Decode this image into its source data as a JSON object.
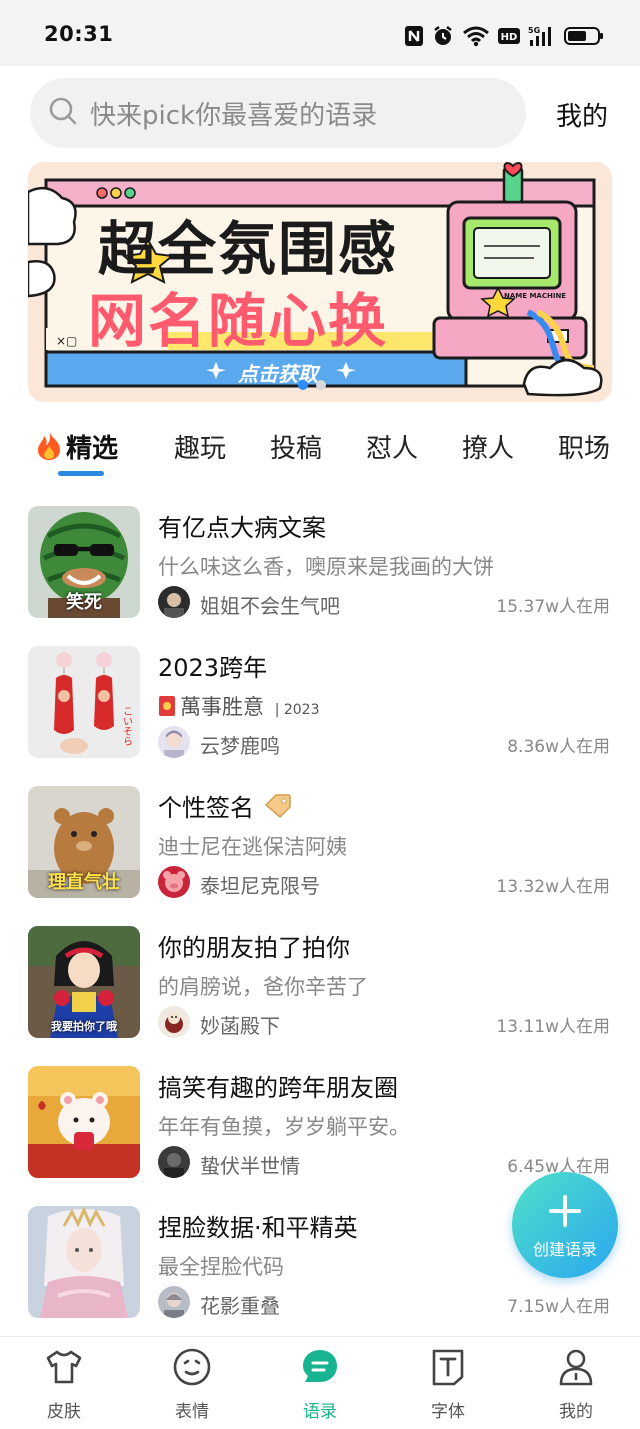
{
  "status_bar": {
    "time": "20:31",
    "icons": [
      "nfc-icon",
      "alarm-icon",
      "wifi-icon",
      "hd-icon",
      "signal-5g-icon",
      "battery-icon"
    ]
  },
  "search": {
    "placeholder": "快来pick你最喜爱的语录",
    "icon": "search-icon"
  },
  "header": {
    "mine_link": "我的"
  },
  "banner": {
    "line1": "超全氛围感",
    "line2": "网名随心换",
    "cta": "点击获取",
    "machine_label": "NAME MACHINE",
    "slide_count": 2,
    "active_slide": 0
  },
  "tabs": [
    {
      "label": "精选",
      "icon": "fire-icon",
      "active": true
    },
    {
      "label": "趣玩"
    },
    {
      "label": "投稿"
    },
    {
      "label": "怼人"
    },
    {
      "label": "撩人"
    },
    {
      "label": "职场"
    }
  ],
  "items": [
    {
      "title": "有亿点大病文案",
      "subtitle": "什么味这么香，噢原来是我画的大饼",
      "author": "姐姐不会生气吧",
      "users": "15.37w人在用",
      "thumb_caption": "笑死"
    },
    {
      "title": "2023跨年",
      "subtitle": "萬事胜意",
      "subtitle_tag": "| 2023",
      "author": "云梦鹿鸣",
      "users": "8.36w人在用",
      "thumb_caption": ""
    },
    {
      "title": "个性签名",
      "title_icon": "tag-icon",
      "subtitle": "迪士尼在逃保洁阿姨",
      "author": "泰坦尼克限号",
      "users": "13.32w人在用",
      "thumb_caption": "理直气壮"
    },
    {
      "title": "你的朋友拍了拍你",
      "subtitle": "的肩膀说，爸你辛苦了",
      "author": "妙菡殿下",
      "users": "13.11w人在用",
      "thumb_caption": "我要拍你了哦"
    },
    {
      "title": "搞笑有趣的跨年朋友圈",
      "subtitle": "年年有鱼摸，岁岁躺平安。",
      "author": "蛰伏半世情",
      "users": "6.45w人在用",
      "thumb_caption": ""
    },
    {
      "title": "捏脸数据·和平精英",
      "subtitle": "最全捏脸代码",
      "author": "花影重叠",
      "users": "7.15w人在用",
      "thumb_caption": ""
    }
  ],
  "fab": {
    "label": "创建语录"
  },
  "bottom_nav": [
    {
      "label": "皮肤",
      "icon": "shirt-icon"
    },
    {
      "label": "表情",
      "icon": "emoji-icon"
    },
    {
      "label": "语录",
      "icon": "quote-icon",
      "active": true
    },
    {
      "label": "字体",
      "icon": "font-icon"
    },
    {
      "label": "我的",
      "icon": "profile-icon"
    }
  ],
  "colors": {
    "accent": "#17b48f",
    "tab_underline": "#2a8ae0",
    "fab_start": "#4fe0c8",
    "fab_end": "#2aa7f0"
  }
}
